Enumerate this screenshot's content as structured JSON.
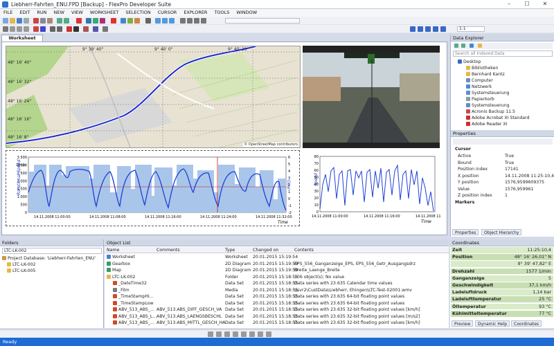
{
  "window": {
    "title": "Liebherr-Fahrten_ENU.FPD [Backup] - FlexPro Developer Suite"
  },
  "menu": [
    "FILE",
    "EDIT",
    "RUN",
    "NEW",
    "VIEW",
    "WORKSHEET",
    "SELECTION",
    "CURSOR",
    "EXPLORER",
    "TOOLS",
    "WINDOW"
  ],
  "toolbar": {
    "zoom": "1:1"
  },
  "worksheet_tab": "Worksheet",
  "map": {
    "lon_labels": [
      "9° 39' 40\"",
      "9° 40' 0\"",
      "9° 40' 20\""
    ],
    "lat_labels": [
      "48° 16' 40\"",
      "48° 16' 32\"",
      "48° 16' 24\"",
      "48° 16' 16\"",
      "48° 16' 8\""
    ],
    "attribution": "© OpenStreetMap contributors"
  },
  "chart1": {
    "y_left_ticks": [
      "3.500",
      "3.000",
      "2.500",
      "2.000",
      "1.500",
      "1.000",
      "500",
      "0"
    ],
    "y_left_unit": "1/min",
    "y_left_label": "Rotational Speed",
    "y_right_ticks": [
      "6",
      "5",
      "4",
      "3",
      "2",
      "1",
      "0",
      "-1",
      "-2"
    ],
    "y_right_label": "Gear",
    "x_ticks": [
      "14.11.2008 11:00:00",
      "14.11.2008 11:08:00",
      "14.11.2008 11:16:00",
      "14.11.2008 11:24:00",
      "14.11.2008 11:32:00"
    ],
    "x_label": "Time"
  },
  "chart2": {
    "y_ticks": [
      "80",
      "70",
      "60",
      "50",
      "40",
      "30",
      "20",
      "10",
      "0"
    ],
    "y_label": "Speed",
    "x_ticks": [
      "14.11.2008 11:00:00",
      "14.11.2008 11:16:00",
      "14.11.2008 11:32:00"
    ],
    "x_label": "Time"
  },
  "data_explorer": {
    "title": "Data Explorer",
    "search_placeholder": "Search all Indexed Data",
    "items": [
      "Desktop",
      "Bibliotheken",
      "Bernhard Kantz",
      "Computer",
      "Netzwerk",
      "Systemsteuerung",
      "Papierkorb",
      "Systemsteuerung",
      "Acronis Backup 11.5",
      "Adobe Acrobat XI Standard",
      "Adobe Reader XI"
    ]
  },
  "properties": {
    "title": "Properties",
    "section": "Cursor",
    "rows": [
      {
        "k": "Active",
        "v": "True"
      },
      {
        "k": "Bound",
        "v": "True"
      },
      {
        "k": "Position index",
        "v": "17141"
      },
      {
        "k": "X position",
        "v": "14.11.2008 11:25:10,4..."
      },
      {
        "k": "Y position",
        "v": "1576,9599609375"
      },
      {
        "k": "Value",
        "v": "1576,959961"
      },
      {
        "k": "Z position index",
        "v": "1"
      }
    ],
    "section2": "Markers",
    "tabs": [
      "Properties",
      "Object Hierarchy"
    ]
  },
  "folders": {
    "title": "Folders",
    "current": "LTC-LK-002",
    "items": [
      "Project Database: 'Liebherr-Fahrten_ENU'",
      "LTC-LK-002",
      "LTC-LK-005"
    ]
  },
  "object_list": {
    "title": "Object List",
    "columns": [
      "Name",
      "Comments",
      "Type",
      "Changed on",
      "Contents"
    ],
    "rows": [
      {
        "name": "Worksheet",
        "comments": "",
        "type": "Worksheet",
        "changed": "20.01.2015 15:19:54",
        "contents": ""
      },
      {
        "name": "Gearbox",
        "comments": "",
        "type": "2D Diagram",
        "changed": "20.01.2015 15:19:59",
        "contents": "EPS_556_Ganganzeige_EPS, EPS_556_Getr_Ausgangsdrz"
      },
      {
        "name": "Map",
        "comments": "",
        "type": "2D Diagram",
        "changed": "20.01.2015 15:19:59",
        "contents": "Breite_Laenge_Breite"
      },
      {
        "name": "LTC-LK-002",
        "comments": "",
        "type": "Folder",
        "changed": "20.01.2015 15:18:55",
        "contents": "106 object(s); No value"
      },
      {
        "name": "_DateTime32",
        "comments": "",
        "type": "Data Set",
        "changed": "20.01.2015 15:18:55",
        "contents": "Data series with 23.635 Calendar time values"
      },
      {
        "name": "_Film",
        "comments": "",
        "type": "Media",
        "changed": "20.01.2015 15:18:55",
        "contents": "\\\\svr2\\CustData\\Liebherr, Ehingen\\LTC-Test-02001.wmv"
      },
      {
        "name": "_TimeStampHi...",
        "comments": "",
        "type": "Data Set",
        "changed": "20.01.2015 15:18:55",
        "contents": "Data series with 23.635 64-bit floating point values"
      },
      {
        "name": "_TimeStampLow",
        "comments": "",
        "type": "Data Set",
        "changed": "20.01.2015 15:18:55",
        "contents": "Data series with 23.635 64-bit floating point values"
      },
      {
        "name": "ABV_513_ABS_...",
        "comments": "ABV_513.ABS_DIFF_GESCH_VA",
        "type": "Data Set",
        "changed": "20.01.2015 15:18:55",
        "contents": "Data series with 23.635 32-bit floating point values [km/h]"
      },
      {
        "name": "ABV_513_ABS_L...",
        "comments": "ABV_513.ABS_LAENGSBESCHL",
        "type": "Data Set",
        "changed": "20.01.2015 15:18:55",
        "contents": "Data series with 23.635 32-bit floating point values [m/s2]"
      },
      {
        "name": "ABV_513_ABS_...",
        "comments": "ABV_513.ABS_MITTL_GESCH_HA",
        "type": "Data Set",
        "changed": "20.01.2015 15:18:55",
        "contents": "Data series with 23.635 32-bit floating point values [km/h]"
      }
    ]
  },
  "coordinates": {
    "title": "Coordinates",
    "rows": [
      {
        "k": "Zeit",
        "v": "11:25:10,4"
      },
      {
        "k": "Position",
        "v": "48° 16' 26,01\" N"
      },
      {
        "k": "",
        "v": "9° 39' 47,82\" E"
      },
      {
        "k": "Drehzahl",
        "v": "1577 1/min"
      },
      {
        "k": "Ganganzeige",
        "v": "5"
      },
      {
        "k": "Geschwindigkeit",
        "v": "37,1 km/h"
      },
      {
        "k": "Ladeluftdruck",
        "v": "1,14 bar"
      },
      {
        "k": "Ladelufttemperatur",
        "v": "25 °C"
      },
      {
        "k": "Öltemperatur",
        "v": "93 °C"
      },
      {
        "k": "Kühlmitteltemperatur",
        "v": "77 °C"
      }
    ],
    "tabs": [
      "Preview",
      "Dynamic Help",
      "Coordinates"
    ]
  },
  "status": {
    "text": "Ready"
  },
  "colors": {
    "accent": "#1e6bd6",
    "trace": "#1f3fd6",
    "fill": "#a9c6ea",
    "cursor": "#d02020"
  }
}
